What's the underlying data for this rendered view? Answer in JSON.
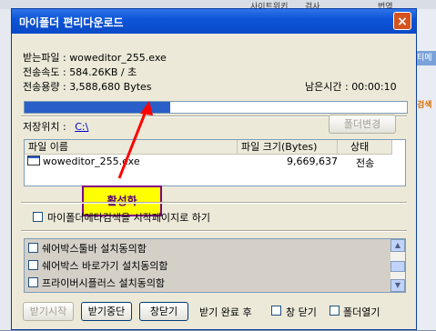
{
  "background": {
    "top_items": [
      "사이트위키",
      "검사",
      "번역"
    ],
    "right_tab": "티메",
    "right_label": "검색"
  },
  "window": {
    "title": "마이폴더 편리다운로드",
    "close": "×"
  },
  "info": {
    "file_label": "받는파일",
    "file_value": "woweditor_255.exe",
    "speed_label": "전송속도",
    "speed_value": "584.26KB / 초",
    "size_label": "전송용량",
    "size_value": "3,588,680 Bytes",
    "remaining_label": "남은시간",
    "remaining_value": "00:00:10",
    "progress": 0.38
  },
  "save": {
    "label": "저장위치 :",
    "path": "C:\\",
    "change_button": "폴더변경"
  },
  "file_list": {
    "columns": [
      "파일 이름",
      "파일 크기(Bytes)",
      "상태"
    ],
    "rows": [
      {
        "name": "woweditor_255.exe",
        "size": "9,669,637",
        "status": "전송"
      }
    ]
  },
  "annotation": "활성화",
  "homepage_checkbox": "마이폴더메타검색을 시작페이지로 하기",
  "agreements": [
    "쉐어박스툴바 설치동의함",
    "쉐어박스 바로가기 설치동의함",
    "프라이버시플러스 설치동의함"
  ],
  "buttons": {
    "start": "받기시작",
    "stop": "받기중단",
    "close": "창닫기",
    "after_label": "받기 완료 후",
    "close_window": "창 닫기",
    "open_folder": "폴더열기"
  },
  "colors": {
    "titlebar": "#0d55d8",
    "progress": "#2a5ec9",
    "annotation_bg": "#ffff00",
    "annotation_border": "#800080",
    "arrow": "#ff0000"
  }
}
